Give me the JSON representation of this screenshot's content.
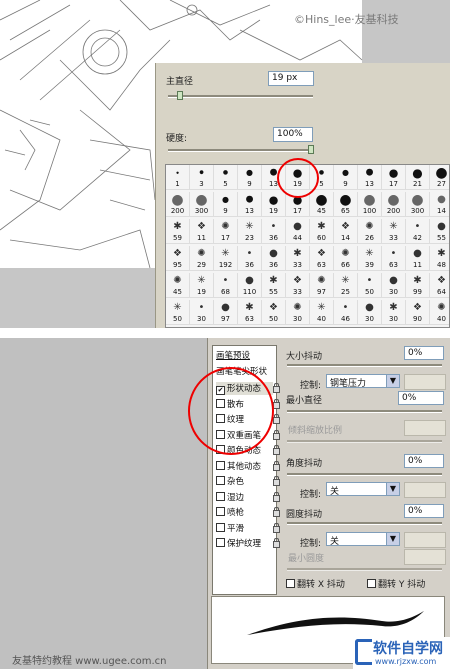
{
  "watermark": {
    "top": "©Hins_lee·友基科技",
    "bottom": "友基特约教程 www.ugee.com.cn",
    "logo": "软件自学网",
    "logo_url": "www.rjzxw.com"
  },
  "top_panel": {
    "diameter_label": "主直径",
    "diameter_value": "19 px",
    "hardness_label": "硬度:",
    "hardness_value": "100%",
    "brush_sizes": [
      [
        "1",
        "3",
        "5",
        "9",
        "13",
        "19",
        "5",
        "9",
        "13",
        "17",
        "21",
        "27"
      ],
      [
        "200",
        "300",
        "9",
        "13",
        "19",
        "17",
        "45",
        "65",
        "100",
        "200",
        "300",
        "14"
      ],
      [
        "59",
        "11",
        "17",
        "23",
        "36",
        "44",
        "60",
        "14",
        "26",
        "33",
        "42",
        "55"
      ],
      [
        "95",
        "29",
        "192",
        "36",
        "36",
        "33",
        "63",
        "66",
        "39",
        "63",
        "11",
        "48"
      ],
      [
        "45",
        "19",
        "68",
        "110",
        "55",
        "33",
        "97",
        "25",
        "50",
        "30",
        "99",
        "64"
      ],
      [
        "50",
        "30",
        "97",
        "63",
        "50",
        "30",
        "40",
        "46",
        "30",
        "30",
        "90",
        "40"
      ]
    ]
  },
  "bottom_panel": {
    "presets": "画笔预设",
    "tip_shape": "画笔笔尖形状",
    "items": [
      {
        "label": "形状动态",
        "checked": true
      },
      {
        "label": "散布",
        "checked": false
      },
      {
        "label": "纹理",
        "checked": false
      },
      {
        "label": "双重画笔",
        "checked": false
      },
      {
        "label": "颜色动态",
        "checked": false
      },
      {
        "label": "其他动态",
        "checked": false
      },
      {
        "label": "杂色",
        "checked": false
      },
      {
        "label": "湿边",
        "checked": false
      },
      {
        "label": "喷枪",
        "checked": false
      },
      {
        "label": "平滑",
        "checked": false
      },
      {
        "label": "保护纹理",
        "checked": false
      }
    ],
    "size_jitter_label": "大小抖动",
    "size_jitter_value": "0%",
    "control_label": "控制:",
    "control1_value": "钢笔压力",
    "min_diameter_label": "最小直径",
    "min_diameter_value": "0%",
    "tilt_scale_label": "倾斜缩放比例",
    "angle_jitter_label": "角度抖动",
    "angle_jitter_value": "0%",
    "control2_value": "关",
    "roundness_jitter_label": "圆度抖动",
    "roundness_jitter_value": "0%",
    "control3_value": "关",
    "min_roundness_label": "最小圆度",
    "flip_x_label": "翻转 X 抖动",
    "flip_y_label": "翻转 Y 抖动"
  }
}
